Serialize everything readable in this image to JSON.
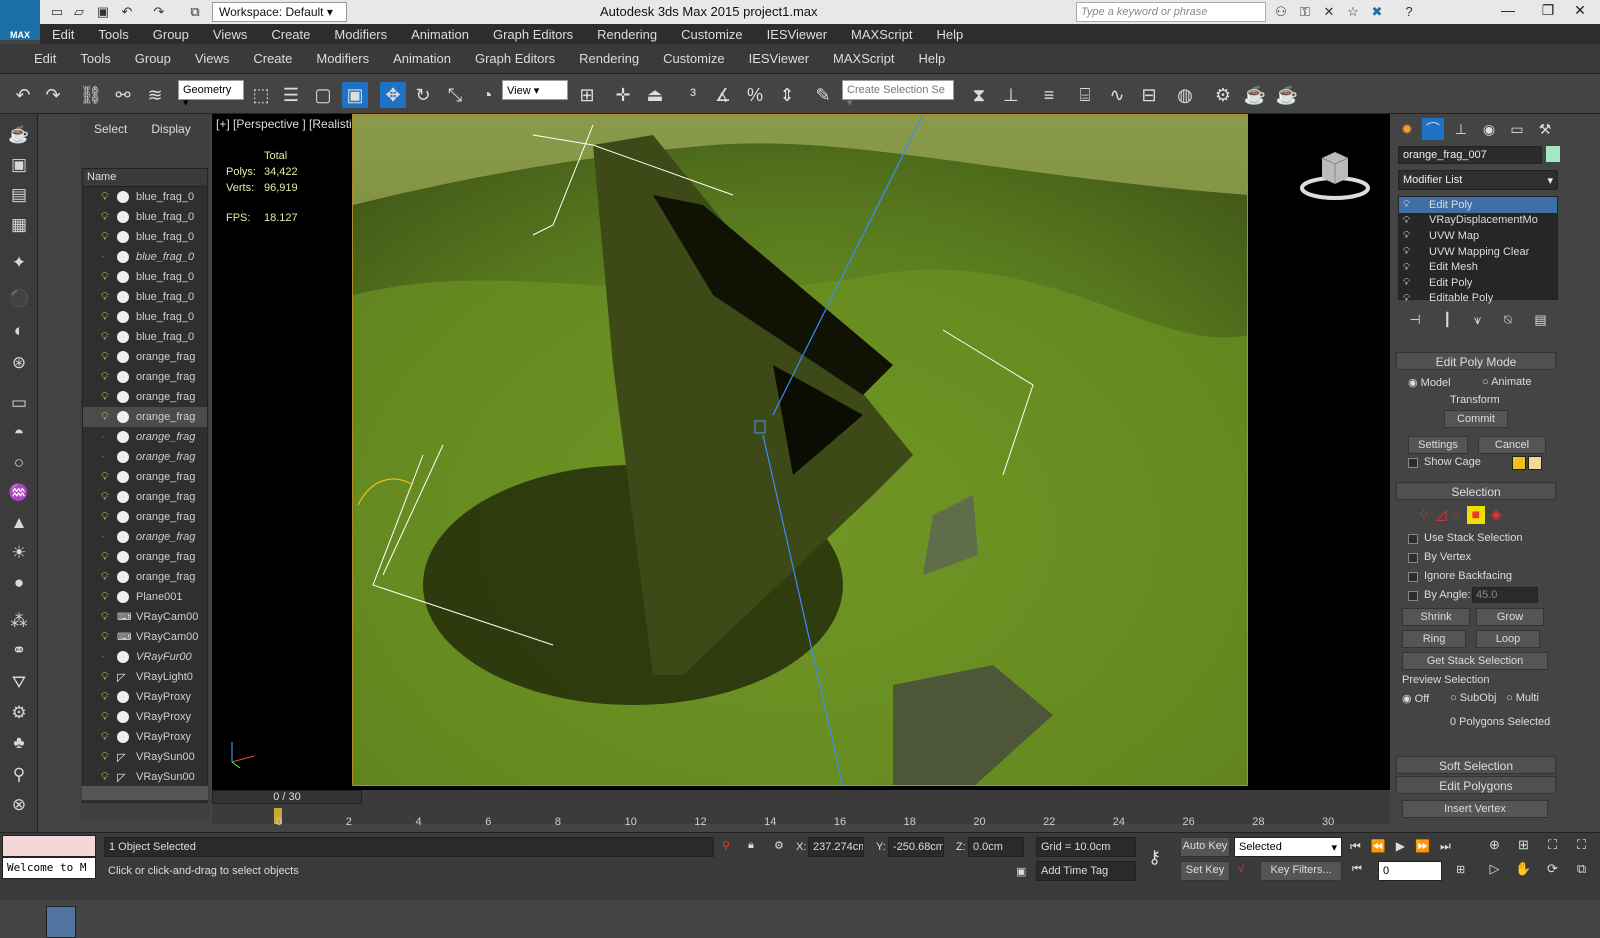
{
  "title_bar": {
    "logo_text": "MAX",
    "workspace": "Workspace: Default",
    "app_title": "Autodesk 3ds Max  2015     project1.max",
    "search_placeholder": "Type a keyword or phrase"
  },
  "menu_top": [
    "Edit",
    "Tools",
    "Group",
    "Views",
    "Create",
    "Modifiers",
    "Animation",
    "Graph Editors",
    "Rendering",
    "Customize",
    "IESViewer",
    "MAXScript",
    "Help"
  ],
  "menu_main": [
    "Edit",
    "Tools",
    "Group",
    "Views",
    "Create",
    "Modifiers",
    "Animation",
    "Graph Editors",
    "Rendering",
    "Customize",
    "IESViewer",
    "MAXScript",
    "Help"
  ],
  "toolbar": {
    "selection_filter": "Geometry",
    "ref_coord": "View",
    "selection_set_placeholder": "Create Selection Se"
  },
  "scene_explorer": {
    "tabs": [
      "Select",
      "Display"
    ],
    "column_header": "Name",
    "items": [
      {
        "name": "blue_frag_0",
        "italic": false,
        "icon": "sphere",
        "on": true
      },
      {
        "name": "blue_frag_0",
        "italic": false,
        "icon": "sphere",
        "on": true
      },
      {
        "name": "blue_frag_0",
        "italic": false,
        "icon": "sphere",
        "on": true
      },
      {
        "name": "blue_frag_0",
        "italic": true,
        "icon": "sphere",
        "on": false
      },
      {
        "name": "blue_frag_0",
        "italic": false,
        "icon": "sphere",
        "on": true
      },
      {
        "name": "blue_frag_0",
        "italic": false,
        "icon": "sphere",
        "on": true
      },
      {
        "name": "blue_frag_0",
        "italic": false,
        "icon": "sphere",
        "on": true
      },
      {
        "name": "blue_frag_0",
        "italic": false,
        "icon": "sphere",
        "on": true
      },
      {
        "name": "orange_frag",
        "italic": false,
        "icon": "sphere",
        "on": true
      },
      {
        "name": "orange_frag",
        "italic": false,
        "icon": "sphere",
        "on": true
      },
      {
        "name": "orange_frag",
        "italic": false,
        "icon": "sphere",
        "on": true
      },
      {
        "name": "orange_frag",
        "italic": false,
        "icon": "sphere",
        "on": true,
        "selected": true
      },
      {
        "name": "orange_frag",
        "italic": true,
        "icon": "sphere",
        "on": false
      },
      {
        "name": "orange_frag",
        "italic": true,
        "icon": "sphere",
        "on": false
      },
      {
        "name": "orange_frag",
        "italic": false,
        "icon": "sphere",
        "on": true
      },
      {
        "name": "orange_frag",
        "italic": false,
        "icon": "sphere",
        "on": true
      },
      {
        "name": "orange_frag",
        "italic": false,
        "icon": "sphere",
        "on": true
      },
      {
        "name": "orange_frag",
        "italic": true,
        "icon": "sphere",
        "on": false
      },
      {
        "name": "orange_frag",
        "italic": false,
        "icon": "sphere",
        "on": true
      },
      {
        "name": "orange_frag",
        "italic": false,
        "icon": "sphere",
        "on": true
      },
      {
        "name": "Plane001",
        "italic": false,
        "icon": "sphere",
        "on": true
      },
      {
        "name": "VRayCam00",
        "italic": false,
        "icon": "camera",
        "on": true
      },
      {
        "name": "VRayCam00",
        "italic": false,
        "icon": "camera",
        "on": true
      },
      {
        "name": "VRayFur00",
        "italic": true,
        "icon": "sphere",
        "on": false
      },
      {
        "name": "VRayLight0",
        "italic": false,
        "icon": "light",
        "on": true
      },
      {
        "name": "VRayProxy",
        "italic": false,
        "icon": "sphere",
        "on": true
      },
      {
        "name": "VRayProxy",
        "italic": false,
        "icon": "sphere",
        "on": true
      },
      {
        "name": "VRayProxy",
        "italic": false,
        "icon": "sphere",
        "on": true
      },
      {
        "name": "VRaySun00",
        "italic": false,
        "icon": "light",
        "on": true
      },
      {
        "name": "VRaySun00",
        "italic": false,
        "icon": "light",
        "on": true
      }
    ]
  },
  "viewport": {
    "label": "[+] [Perspective ] [Realistic ]",
    "stats": {
      "total_label": "Total",
      "polys_label": "Polys:",
      "polys": "34,422",
      "verts_label": "Verts:",
      "verts": "96,919",
      "fps_label": "FPS:",
      "fps": "18.127"
    }
  },
  "command_panel": {
    "object_name": "orange_frag_007",
    "object_color": "#a6e6c0",
    "modifier_list_label": "Modifier List",
    "stack": [
      "Edit Poly",
      "VRayDisplacementMo",
      "UVW Map",
      "UVW Mapping Clear",
      "Edit Mesh",
      "Edit Poly",
      "Editable Poly"
    ],
    "edit_poly_mode": {
      "title": "Edit Poly Mode",
      "model": "Model",
      "animate": "Animate",
      "transform": "Transform",
      "commit": "Commit",
      "settings": "Settings",
      "cancel": "Cancel",
      "show_cage": "Show Cage"
    },
    "selection": {
      "title": "Selection",
      "use_stack": "Use Stack Selection",
      "by_vertex": "By Vertex",
      "ignore_backfacing": "Ignore Backfacing",
      "by_angle": "By Angle:",
      "angle_value": "45.0",
      "shrink": "Shrink",
      "grow": "Grow",
      "ring": "Ring",
      "loop": "Loop",
      "get_stack": "Get Stack Selection",
      "preview_title": "Preview Selection",
      "preview_off": "Off",
      "preview_subobj": "SubObj",
      "preview_multi": "Multi",
      "polygons_selected": "0 Polygons Selected"
    },
    "soft_selection": "Soft Selection",
    "edit_polygons": "Edit Polygons",
    "insert_vertex": "Insert Vertex"
  },
  "timeline": {
    "slider": "0 / 30",
    "ticks": [
      "0",
      "2",
      "4",
      "6",
      "8",
      "10",
      "12",
      "14",
      "16",
      "18",
      "20",
      "22",
      "24",
      "26",
      "28",
      "30"
    ]
  },
  "status": {
    "listener": "Welcome to M",
    "selected": "1 Object Selected",
    "prompt": "Click or click-and-drag to select objects",
    "x_label": "X:",
    "x": "237.274cm",
    "y_label": "Y:",
    "y": "-250.68cm",
    "z_label": "Z:",
    "z": "0.0cm",
    "grid": "Grid = 10.0cm",
    "add_time_tag": "Add Time Tag",
    "auto_key": "Auto Key",
    "set_key": "Set Key",
    "key_mode": "Selected",
    "key_filters": "Key Filters...",
    "frame": "0"
  }
}
